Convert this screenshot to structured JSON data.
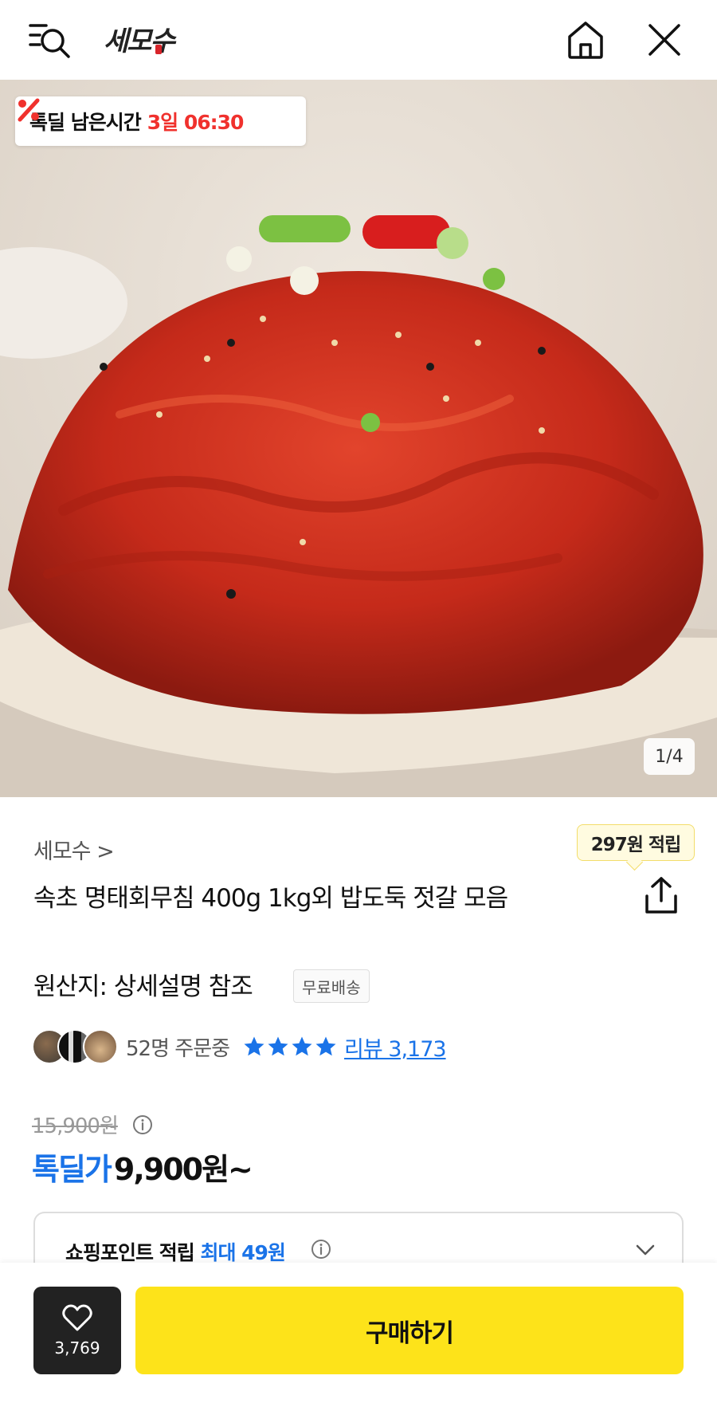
{
  "header": {
    "logo_text": "세모수",
    "icons": [
      "menu-search-icon",
      "home-icon",
      "close-icon"
    ]
  },
  "hero": {
    "deal_badge": {
      "label": "톡딜 남은시간",
      "time": "3일 06:30"
    },
    "page_indicator": "1/4"
  },
  "product": {
    "seller": "세모수 >",
    "points_bubble": "297원 적립",
    "title": "속초 명태회무침 400g 1kg외 밥도둑 젓갈 모음",
    "origin": "원산지: 상세설명 참조",
    "shipping_badge": "무료배송",
    "orders": "52명 주문중",
    "rating_stars": 4,
    "reviews": "리뷰 3,173"
  },
  "price": {
    "original": "15,900원",
    "deal_label": "톡딜가",
    "deal_price": "9,900원~"
  },
  "shopping_points": {
    "label": "쇼핑포인트 적립",
    "max": "최대 49원"
  },
  "bottom_bar": {
    "like_count": "3,769",
    "buy_label": "구매하기"
  },
  "colors": {
    "accent_blue": "#1a73e8",
    "deal_red": "#f0312d",
    "buy_yellow": "#fde31a"
  }
}
